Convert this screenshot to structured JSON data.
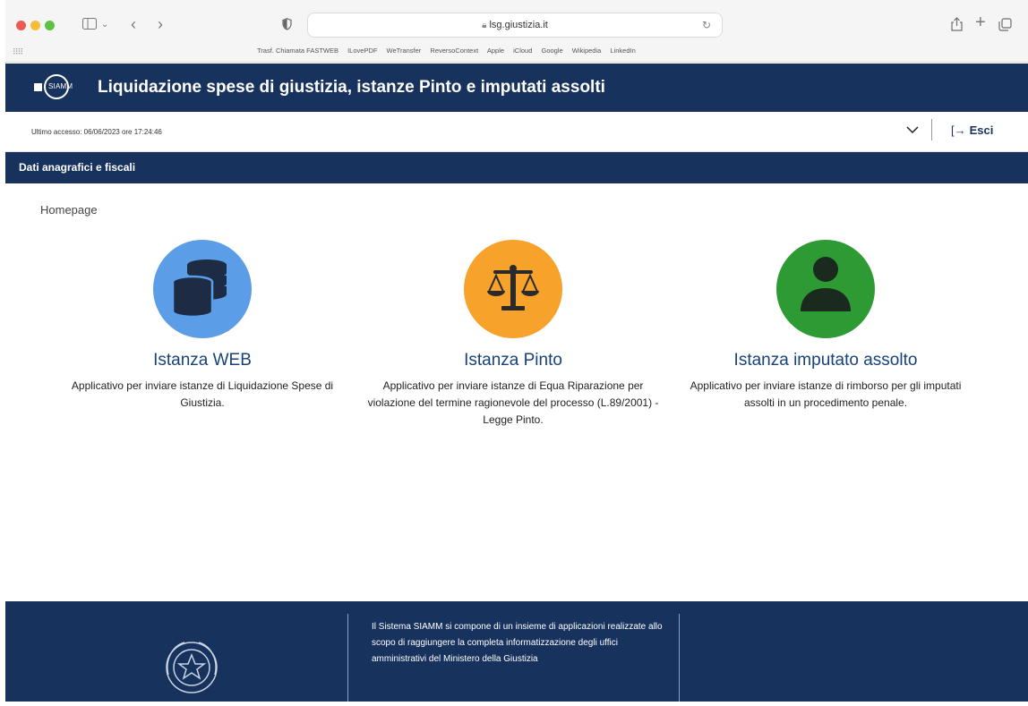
{
  "browser": {
    "url": "lsg.giustizia.it",
    "bookmarks": [
      "Trasf. Chiamata FASTWEB",
      "ILovePDF",
      "WeTransfer",
      "ReversoContext",
      "Apple",
      "iCloud",
      "Google",
      "Wikipedia",
      "LinkedIn"
    ]
  },
  "header": {
    "logo_text": "SIAMM",
    "title": "Liquidazione spese di giustizia, istanze Pinto e imputati assolti"
  },
  "info_bar": {
    "last_access": "Ultimo accesso: 06/06/2023 ore 17:24:46",
    "logout_label": "Esci"
  },
  "nav": {
    "item": "Dati anagrafici e fiscali"
  },
  "breadcrumb": "Homepage",
  "cards": [
    {
      "title": "Istanza WEB",
      "description": "Applicativo per inviare istanze di Liquidazione Spese di Giustizia.",
      "icon": "coins-icon",
      "color": "#5b9de6"
    },
    {
      "title": "Istanza Pinto",
      "description": "Applicativo per inviare istanze di Equa Riparazione per violazione del termine ragionevole del processo (L.89/2001) - Legge Pinto.",
      "icon": "scales-icon",
      "color": "#f7a22a"
    },
    {
      "title": "Istanza imputato assolto",
      "description": "Applicativo per inviare istanze di rimborso per gli imputati assolti in un procedimento penale.",
      "icon": "user-icon",
      "color": "#2e9a33"
    }
  ],
  "footer": {
    "text": "Il Sistema SIAMM si compone di un insieme di applicazioni realizzate allo scopo di raggiungere la completa informatizzazione degli uffici amministrativi del Ministero della Giustizia"
  },
  "colors": {
    "primary": "#17325d",
    "title_blue": "#17427a"
  }
}
